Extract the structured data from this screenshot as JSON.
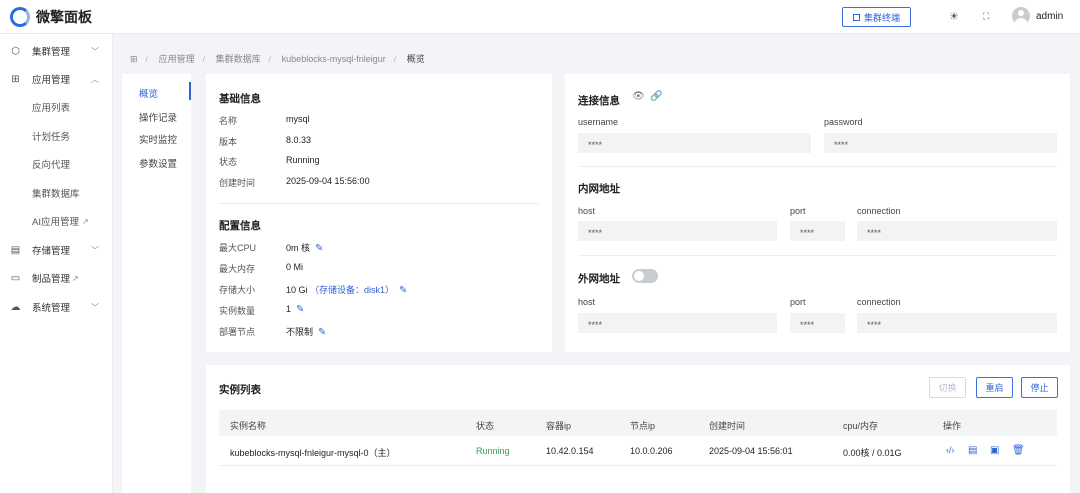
{
  "header": {
    "logo_text": "微擎面板",
    "terminal_btn": "集群终端",
    "user": "admin",
    "icons": [
      "sun-icon",
      "fullscreen-icon"
    ]
  },
  "sidebar": {
    "items": [
      {
        "icon": "cube-icon",
        "label": "集群管理",
        "expanded": false
      },
      {
        "icon": "grid-icon",
        "label": "应用管理",
        "expanded": true
      },
      {
        "label": "应用列表"
      },
      {
        "label": "计划任务"
      },
      {
        "label": "反向代理"
      },
      {
        "label": "集群数据库"
      },
      {
        "label": "AI应用管理",
        "external": true
      },
      {
        "icon": "storage-icon",
        "label": "存储管理",
        "expanded": false
      },
      {
        "icon": "archive-icon",
        "label": "制品管理",
        "external": true
      },
      {
        "icon": "cloud-icon",
        "label": "系统管理",
        "expanded": false
      }
    ]
  },
  "breadcrumb": [
    "应用管理",
    "集群数据库",
    "kubeblocks-mysql-fnleigur",
    "概览"
  ],
  "tabs": [
    "概览",
    "操作记录",
    "实时监控",
    "参数设置"
  ],
  "basic": {
    "title": "基础信息",
    "rows": [
      {
        "k": "名称",
        "v": "mysql"
      },
      {
        "k": "版本",
        "v": "8.0.33"
      },
      {
        "k": "状态",
        "v": "Running"
      },
      {
        "k": "创建时间",
        "v": "2025-09-04 15:56:00"
      }
    ]
  },
  "config": {
    "title": "配置信息",
    "rows": [
      {
        "k": "最大CPU",
        "v": "0m 核"
      },
      {
        "k": "最大内存",
        "v": "0 Mi"
      },
      {
        "k": "存储大小",
        "v": "10 Gi",
        "extra": "（存储设备：disk1）"
      },
      {
        "k": "实例数量",
        "v": "1"
      },
      {
        "k": "部署节点",
        "v": "不限制"
      }
    ]
  },
  "conn": {
    "title": "连接信息",
    "username_label": "username",
    "username": "****",
    "password_label": "password",
    "password": "****",
    "internal_title": "内网地址",
    "external_title": "外网地址",
    "host_label": "host",
    "port_label": "port",
    "connection_label": "connection",
    "int_host": "****",
    "int_port": "****",
    "int_conn": "****",
    "ext_host": "****",
    "ext_port": "****",
    "ext_conn": "****"
  },
  "instances": {
    "title": "实例列表",
    "btn_switch": "切换",
    "btn_restart": "重启",
    "btn_stop": "停止",
    "columns": [
      "实例名称",
      "状态",
      "容器ip",
      "节点ip",
      "创建时间",
      "cpu/内存",
      "操作"
    ],
    "rows": [
      {
        "name": "kubeblocks-mysql-fnleigur-mysql-0（主）",
        "status": "Running",
        "container_ip": "10.42.0.154",
        "node_ip": "10.0.0.206",
        "created": "2025-09-04 15:56:01",
        "usage": "0.00核 / 0.01G"
      }
    ]
  },
  "colors": {
    "accent": "#2f63d6",
    "running": "#3f9a4f"
  }
}
